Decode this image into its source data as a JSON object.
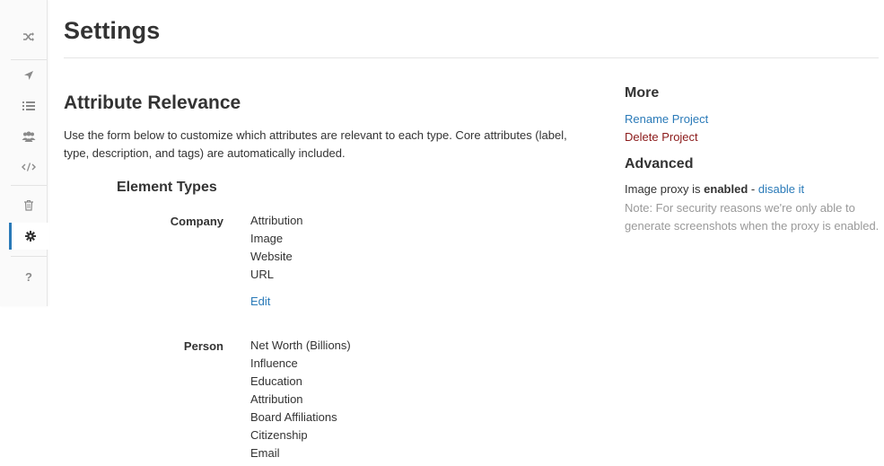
{
  "colors": {
    "link": "#2a7ab8",
    "danger": "#8b1a1a",
    "muted": "#999999",
    "text": "#333333"
  },
  "sidebar": {
    "items": [
      {
        "icon": "shuffle-icon"
      },
      {
        "icon": "location-arrow-icon"
      },
      {
        "icon": "list-icon"
      },
      {
        "icon": "users-icon"
      },
      {
        "icon": "code-icon"
      },
      {
        "icon": "trash-icon"
      },
      {
        "icon": "gear-icon",
        "active": true
      },
      {
        "icon": "question-icon",
        "label": "?"
      }
    ]
  },
  "page": {
    "title": "Settings"
  },
  "relevance": {
    "title": "Attribute Relevance",
    "description": "Use the form below to customize which attributes are relevant to each type. Core attributes (label, type, description, and tags) are automatically included.",
    "subtitle": "Element Types",
    "types": [
      {
        "name": "Company",
        "attributes": [
          "Attribution",
          "Image",
          "Website",
          "URL"
        ],
        "edit_label": "Edit"
      },
      {
        "name": "Person",
        "attributes": [
          "Net Worth (Billions)",
          "Influence",
          "Education",
          "Attribution",
          "Board Affiliations",
          "Citizenship",
          "Email"
        ]
      }
    ]
  },
  "more": {
    "heading": "More",
    "rename_label": "Rename Project",
    "delete_label": "Delete Project"
  },
  "advanced": {
    "heading": "Advanced",
    "proxy_prefix": "Image proxy is ",
    "proxy_state": "enabled",
    "proxy_sep": " - ",
    "proxy_action": "disable it",
    "note": "Note: For security reasons we're only able to generate screenshots when the proxy is enabled."
  }
}
